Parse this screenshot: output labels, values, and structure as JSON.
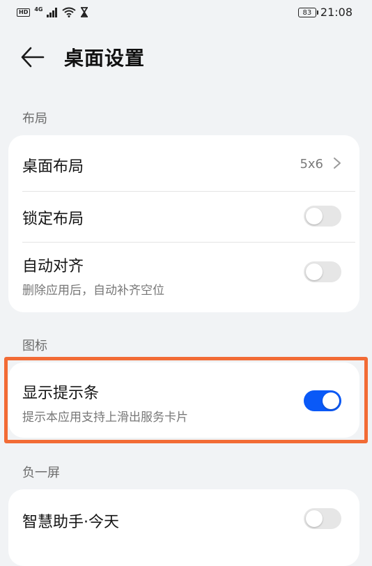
{
  "status_bar": {
    "hd": "HD",
    "network": "4G",
    "battery": "83",
    "time": "21:08"
  },
  "header": {
    "title": "桌面设置"
  },
  "sections": {
    "layout": {
      "label": "布局",
      "desktop_layout": {
        "title": "桌面布局",
        "value": "5x6"
      },
      "lock_layout": {
        "title": "锁定布局",
        "enabled": false
      },
      "auto_align": {
        "title": "自动对齐",
        "subtitle": "删除应用后，自动补齐空位",
        "enabled": false
      }
    },
    "icons": {
      "label": "图标",
      "show_hint_bar": {
        "title": "显示提示条",
        "subtitle": "提示本应用支持上滑出服务卡片",
        "enabled": true
      }
    },
    "minus_one_screen": {
      "label": "负一屏",
      "smart_assistant": {
        "title": "智慧助手·今天",
        "enabled": false
      }
    }
  },
  "colors": {
    "accent": "#0a59f7",
    "highlight": "#f26b35",
    "background": "#f1f3f5"
  }
}
